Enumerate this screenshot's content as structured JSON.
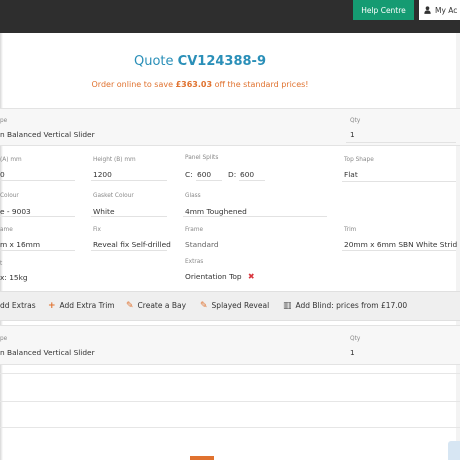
{
  "header": {
    "help_label": "Help Centre",
    "account_label": "My Ac"
  },
  "quote": {
    "prefix": "Quote",
    "number": "CV124388-9",
    "save_prefix": "Order online to save",
    "save_amount": "£363.03",
    "save_suffix": "off the standard prices!"
  },
  "item1": {
    "type_label": "pe",
    "type_value": "n Balanced Vertical Slider",
    "qty_label": "Qty",
    "qty_value": "1",
    "width_label": "(A) mm",
    "width_value": "0",
    "height_label": "Height (B) mm",
    "height_value": "1200",
    "panel_label": "Panel Splits",
    "panel_c_label": "C:",
    "panel_c_value": "600",
    "panel_d_label": "D:",
    "panel_d_value": "600",
    "top_shape_label": "Top Shape",
    "top_shape_value": "Flat",
    "colour_label": "Colour",
    "colour_value": "e - 9003",
    "gasket_label": "Gasket Colour",
    "gasket_value": "White",
    "glass_label": "Glass",
    "glass_value": "4mm Toughened",
    "frame_size_label": "ame",
    "frame_size_value": "m x 16mm",
    "fix_label": "Fix",
    "fix_value": "Reveal fix Self-drilled",
    "frame_label": "Frame",
    "frame_value": "Standard",
    "trim_label": "Trim",
    "trim_value": "20mm x 6mm SBN White Strid",
    "weight_label": "t",
    "weight_value": "x: 15kg",
    "extras_label": "Extras",
    "extras_value": "Orientation Top"
  },
  "toolbar": {
    "add_extras": "dd Extras",
    "add_extra_trim": "Add Extra Trim",
    "create_bay": "Create a Bay",
    "splayed_reveal": "Splayed Reveal",
    "add_blind": "Add Blind: prices from £17.00"
  },
  "item2": {
    "type_label": "pe",
    "type_value": "n Balanced Vertical Slider",
    "qty_label": "Qty",
    "qty_value": "1"
  },
  "colors": {
    "accent_blue": "#2a8fb8",
    "accent_orange": "#e0722f",
    "help_green": "#159b72",
    "topbar": "#2e2e2e"
  }
}
